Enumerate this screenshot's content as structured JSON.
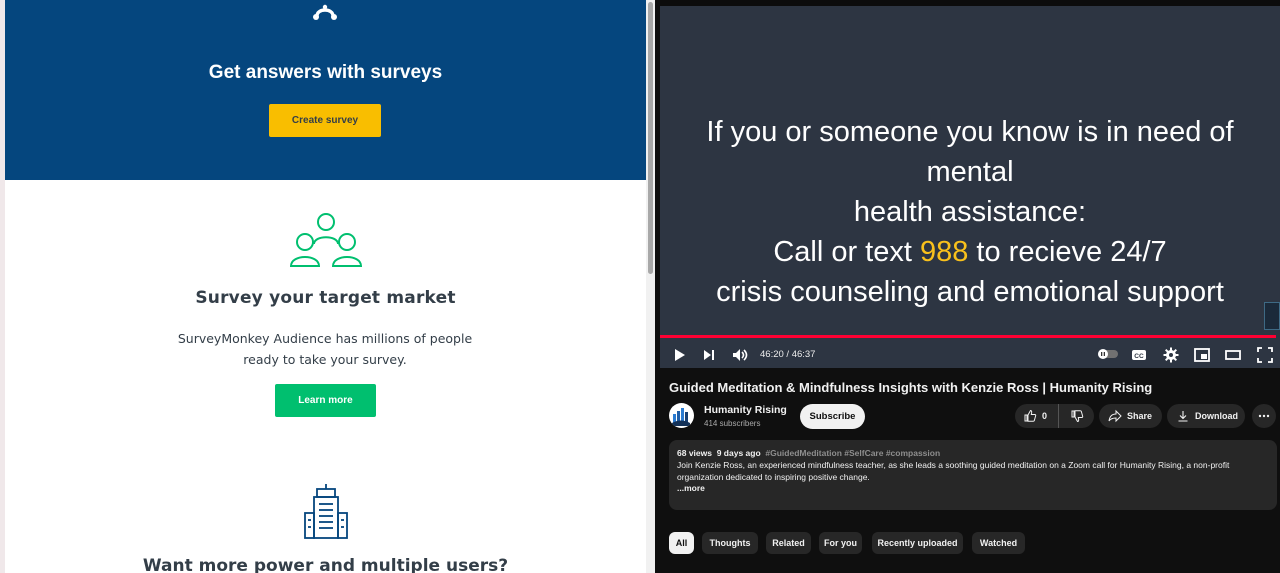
{
  "left_page": {
    "hero": {
      "title": "Get answers with surveys",
      "create_button": "Create survey",
      "logo_icon": "surveymonkey-logo-icon"
    },
    "audience_section": {
      "icon": "people-group-icon",
      "title": "Survey your target market",
      "description": "SurveyMonkey Audience has millions of people ready to take your survey.",
      "learn_button": "Learn more"
    },
    "teams_section": {
      "icon": "building-icon",
      "title": "Want more power and multiple users?"
    },
    "colors": {
      "hero_bg": "#05467e",
      "create_btn": "#f9be00",
      "learn_btn": "#00bf6f",
      "accent_green": "#00bf6f"
    }
  },
  "video_page": {
    "player": {
      "slide_line1": "If you or someone you know is in need of mental",
      "slide_line2": "health assistance:",
      "slide_line3_before": "Call or text ",
      "slide_line3_highlight": "988",
      "slide_line3_after": " to recieve 24/7",
      "slide_line4": "crisis counseling and emotional support",
      "time": "46:20 / 46:37",
      "progress_fraction": 0.9939
    },
    "title": "Guided Meditation & Mindfulness Insights with Kenzie Ross | Humanity Rising",
    "channel": {
      "name": "Humanity Rising",
      "subscribers": "414 subscribers",
      "subscribe_label": "Subscribe"
    },
    "actions": {
      "like_count": "0",
      "share_label": "Share",
      "download_label": "Download"
    },
    "description": {
      "views": "68 views",
      "date": "9 days ago",
      "tags": "#GuidedMeditation #SelfCare #compassion",
      "text": "Join Kenzie Ross, an experienced mindfulness teacher, as she leads a soothing guided meditation on a Zoom call for Humanity Rising, a non-profit organization dedicated to inspiring positive change.",
      "more": "...more"
    },
    "chips": [
      "All",
      "Thoughts",
      "Related",
      "For you",
      "Recently uploaded",
      "Watched"
    ],
    "colors": {
      "bg": "#0f0f0f",
      "slide_bg": "#2d3542",
      "highlight": "#f9c11c",
      "progress": "#ff0033"
    }
  }
}
